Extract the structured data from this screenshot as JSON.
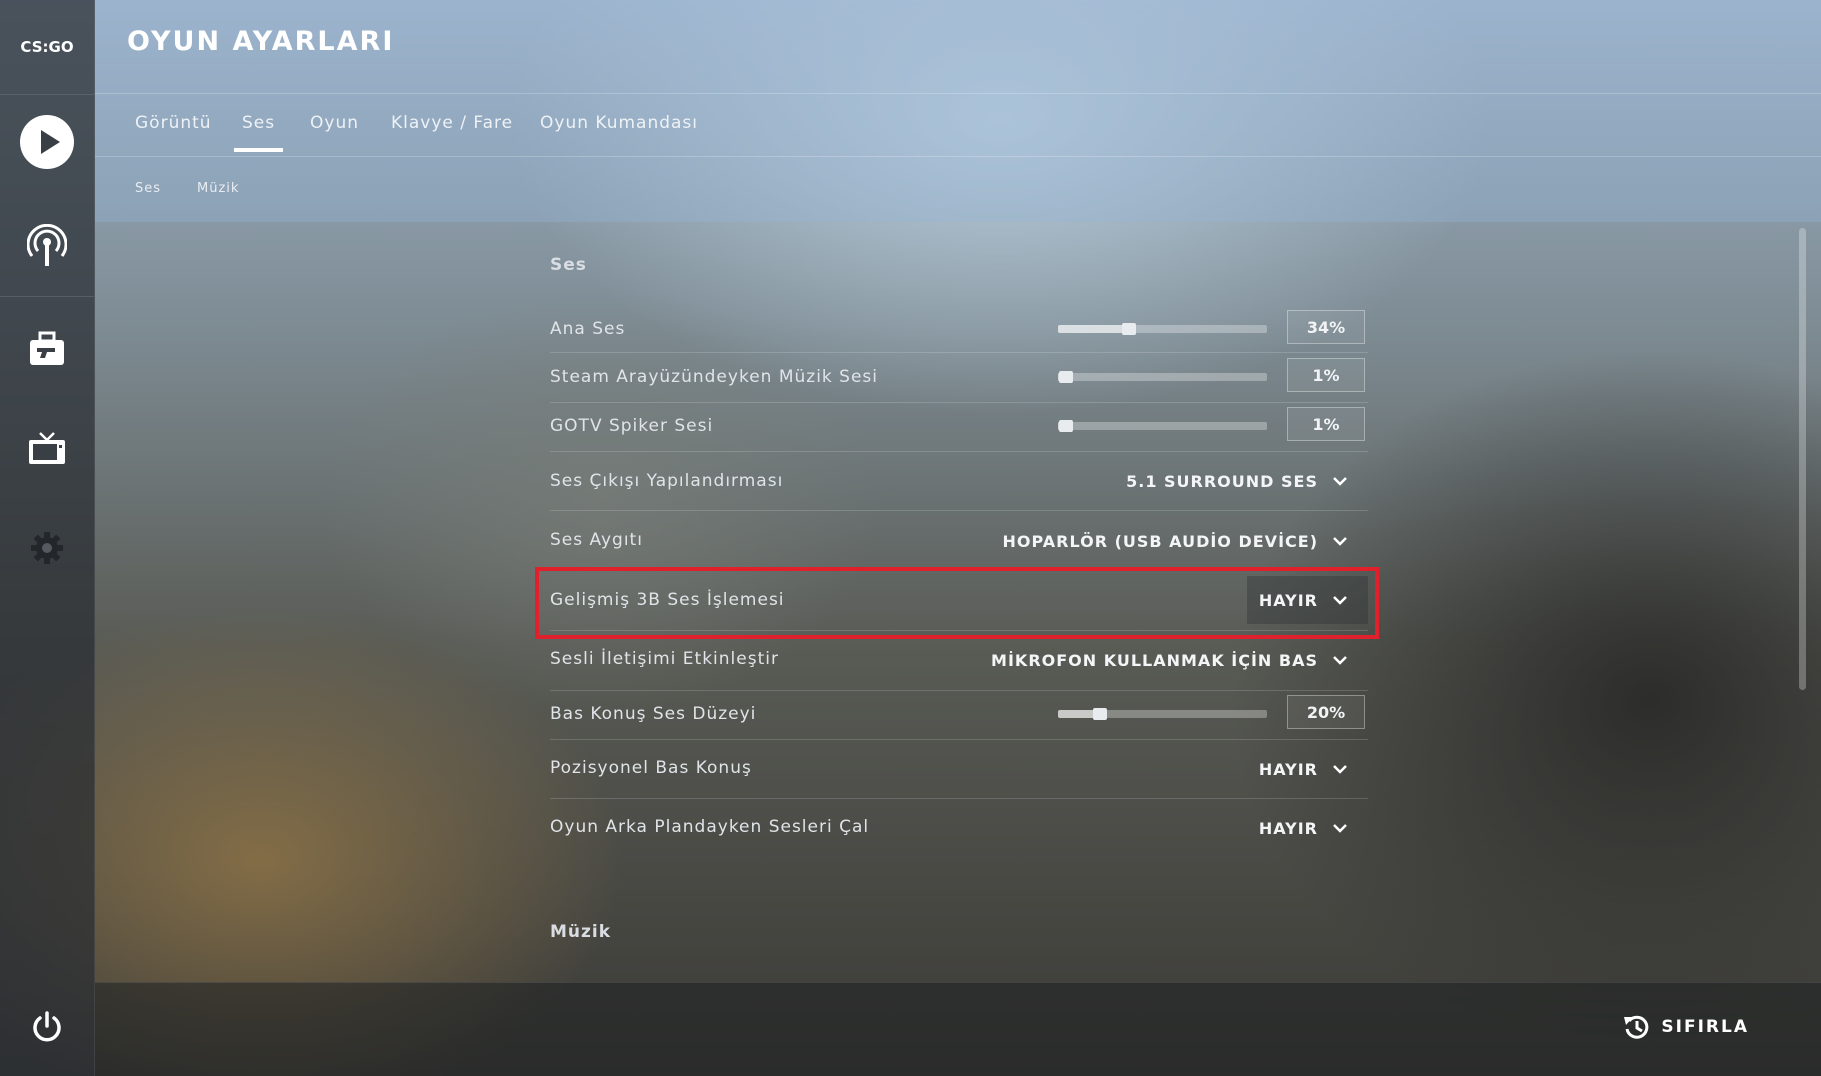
{
  "app": {
    "logo_text": "CS:GO",
    "page_title": "OYUN AYARLARI"
  },
  "sidebar": {
    "items": [
      {
        "icon": "play-icon"
      },
      {
        "icon": "broadcast-icon"
      },
      {
        "icon": "inventory-briefcase-icon"
      },
      {
        "icon": "tv-icon"
      },
      {
        "icon": "gear-icon"
      },
      {
        "icon": "power-icon"
      }
    ]
  },
  "tabs": [
    {
      "label": "Görüntü",
      "active": false
    },
    {
      "label": "Ses",
      "active": true
    },
    {
      "label": "Oyun",
      "active": false
    },
    {
      "label": "Klavye / Fare",
      "active": false
    },
    {
      "label": "Oyun Kumandası",
      "active": false
    }
  ],
  "subtabs": [
    {
      "label": "Ses"
    },
    {
      "label": "Müzik"
    }
  ],
  "sections": {
    "ses": "Ses",
    "muzik": "Müzik"
  },
  "settings": [
    {
      "label": "Ana Ses",
      "type": "slider",
      "value": "34%",
      "level": 0.34
    },
    {
      "label": "Steam Arayüzündeyken Müzik Sesi",
      "type": "slider",
      "value": "1%",
      "level": 0.01
    },
    {
      "label": "GOTV Spiker Sesi",
      "type": "slider",
      "value": "1%",
      "level": 0.01
    },
    {
      "label": "Ses Çıkışı Yapılandırması",
      "type": "dropdown",
      "value": "5.1 SURROUND SES"
    },
    {
      "label": "Ses Aygıtı",
      "type": "dropdown",
      "value": "HOPARLÖR (USB AUDİO DEVİCE)"
    },
    {
      "label": "Gelişmiş 3B Ses İşlemesi",
      "type": "dropdown",
      "value": "HAYIR",
      "highlighted": true
    },
    {
      "label": "Sesli İletişimi Etkinleştir",
      "type": "dropdown",
      "value": "MİKROFON KULLANMAK İÇİN BAS"
    },
    {
      "label": "Bas Konuş Ses Düzeyi",
      "type": "slider",
      "value": "20%",
      "level": 0.2
    },
    {
      "label": "Pozisyonel Bas Konuş",
      "type": "dropdown",
      "value": "HAYIR"
    },
    {
      "label": "Oyun Arka Plandayken Sesleri Çal",
      "type": "dropdown",
      "value": "HAYIR"
    }
  ],
  "footer": {
    "reset_label": "SIFIRLA"
  },
  "colors": {
    "highlight": "#e0202a",
    "text": "#e0e4e8"
  }
}
